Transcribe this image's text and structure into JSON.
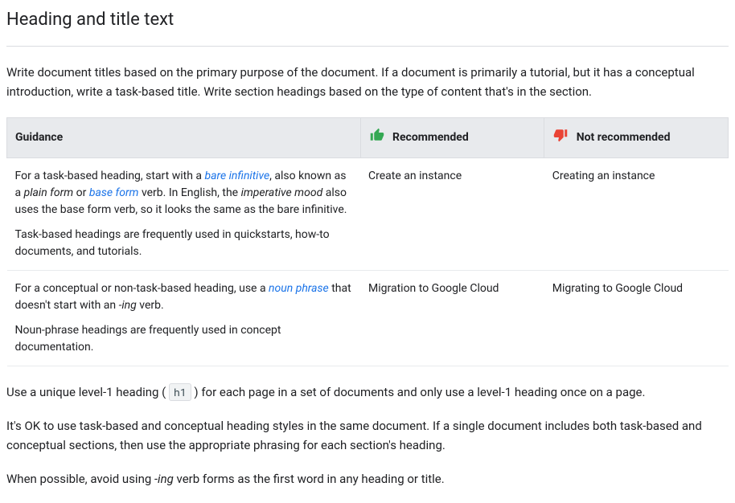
{
  "title": "Heading and title text",
  "intro": "Write document titles based on the primary purpose of the document. If a document is primarily a tutorial, but it has a conceptual introduction, write a task-based title. Write section headings based on the type of content that's in the section.",
  "table": {
    "headers": {
      "guidance": "Guidance",
      "recommended": "Recommended",
      "not_recommended": "Not recommended"
    },
    "rows": [
      {
        "guidance": {
          "p1_a": "For a task-based heading, start with a ",
          "p1_link1": "bare infinitive",
          "p1_b": ", also known as a ",
          "p1_ital1": "plain form",
          "p1_c": " or ",
          "p1_link2": "base form",
          "p1_d": " verb. In English, the ",
          "p1_ital2": "imperative mood",
          "p1_e": " also uses the base form verb, so it looks the same as the bare infinitive.",
          "p2": "Task-based headings are frequently used in quickstarts, how-to documents, and tutorials."
        },
        "recommended": "Create an instance",
        "not_recommended": "Creating an instance"
      },
      {
        "guidance": {
          "p1_a": "For a conceptual or non-task-based heading, use a ",
          "p1_link1": "noun phrase",
          "p1_b": " that doesn't start with an ",
          "p1_ital1": "-ing",
          "p1_c": " verb.",
          "p2": "Noun-phrase headings are frequently used in concept documentation."
        },
        "recommended": "Migration to Google Cloud",
        "not_recommended": "Migrating to Google Cloud"
      }
    ]
  },
  "para1_a": "Use a unique level-1 heading (",
  "para1_code": "h1",
  "para1_b": ") for each page in a set of documents and only use a level-1 heading once on a page.",
  "para2": "It's OK to use task-based and conceptual heading styles in the same document. If a single document includes both task-based and conceptual sections, then use the appropriate phrasing for each section's heading.",
  "para3_a": "When possible, avoid using ",
  "para3_ital": "-ing",
  "para3_b": " verb forms as the first word in any heading or title."
}
